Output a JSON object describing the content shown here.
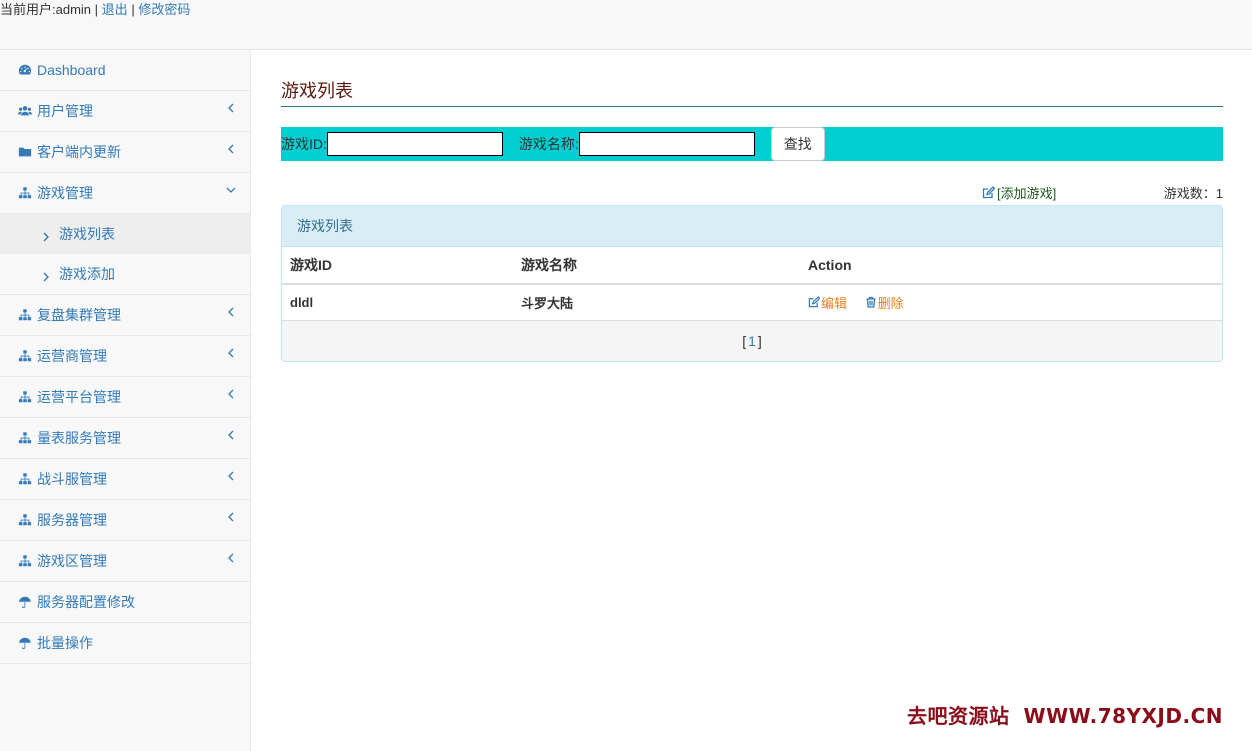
{
  "topbar": {
    "current_user_label": "当前用户:admin",
    "separator": "|",
    "logout": "退出",
    "change_password": "修改密码"
  },
  "sidebar": {
    "items": [
      {
        "label": "Dashboard",
        "icon": "dashboard-icon"
      },
      {
        "label": "用户管理",
        "icon": "users-icon"
      },
      {
        "label": "客户端内更新",
        "icon": "folder-icon"
      },
      {
        "label": "游戏管理",
        "icon": "sitemap-icon"
      },
      {
        "label": "复盘集群管理",
        "icon": "sitemap-icon"
      },
      {
        "label": "运营商管理",
        "icon": "sitemap-icon"
      },
      {
        "label": "运营平台管理",
        "icon": "sitemap-icon"
      },
      {
        "label": "量表服务管理",
        "icon": "sitemap-icon"
      },
      {
        "label": "战斗服管理",
        "icon": "sitemap-icon"
      },
      {
        "label": "服务器管理",
        "icon": "sitemap-icon"
      },
      {
        "label": "游戏区管理",
        "icon": "sitemap-icon"
      },
      {
        "label": "服务器配置修改",
        "icon": "umbrella-icon"
      },
      {
        "label": "批量操作",
        "icon": "umbrella-icon"
      }
    ],
    "game_submenu": [
      {
        "label": "游戏列表",
        "active": true
      },
      {
        "label": "游戏添加",
        "active": false
      }
    ]
  },
  "main": {
    "title": "游戏列表",
    "search": {
      "game_id_label": "游戏ID:",
      "game_id_value": "",
      "game_name_label": "游戏名称:",
      "game_name_value": "",
      "search_button": "查找"
    },
    "add_game_link": "[添加游戏]",
    "game_count": "游戏数：1",
    "panel_title": "游戏列表",
    "table": {
      "headers": [
        "游戏ID",
        "游戏名称",
        "Action"
      ],
      "rows": [
        {
          "id": "dldl",
          "name": "斗罗大陆",
          "edit": "编辑",
          "delete": "删除"
        }
      ]
    },
    "pagination": {
      "open": "[",
      "page": "1",
      "close": "]"
    }
  },
  "watermark": {
    "text1": "去吧资源站",
    "text2": "WWW.78YXJD.CN"
  },
  "colors": {
    "link": "#337ab7",
    "searchbar": "#00ced1",
    "panel_heading": "#d9edf7",
    "action": "#e8821e",
    "watermark": "#8b0d1a"
  }
}
